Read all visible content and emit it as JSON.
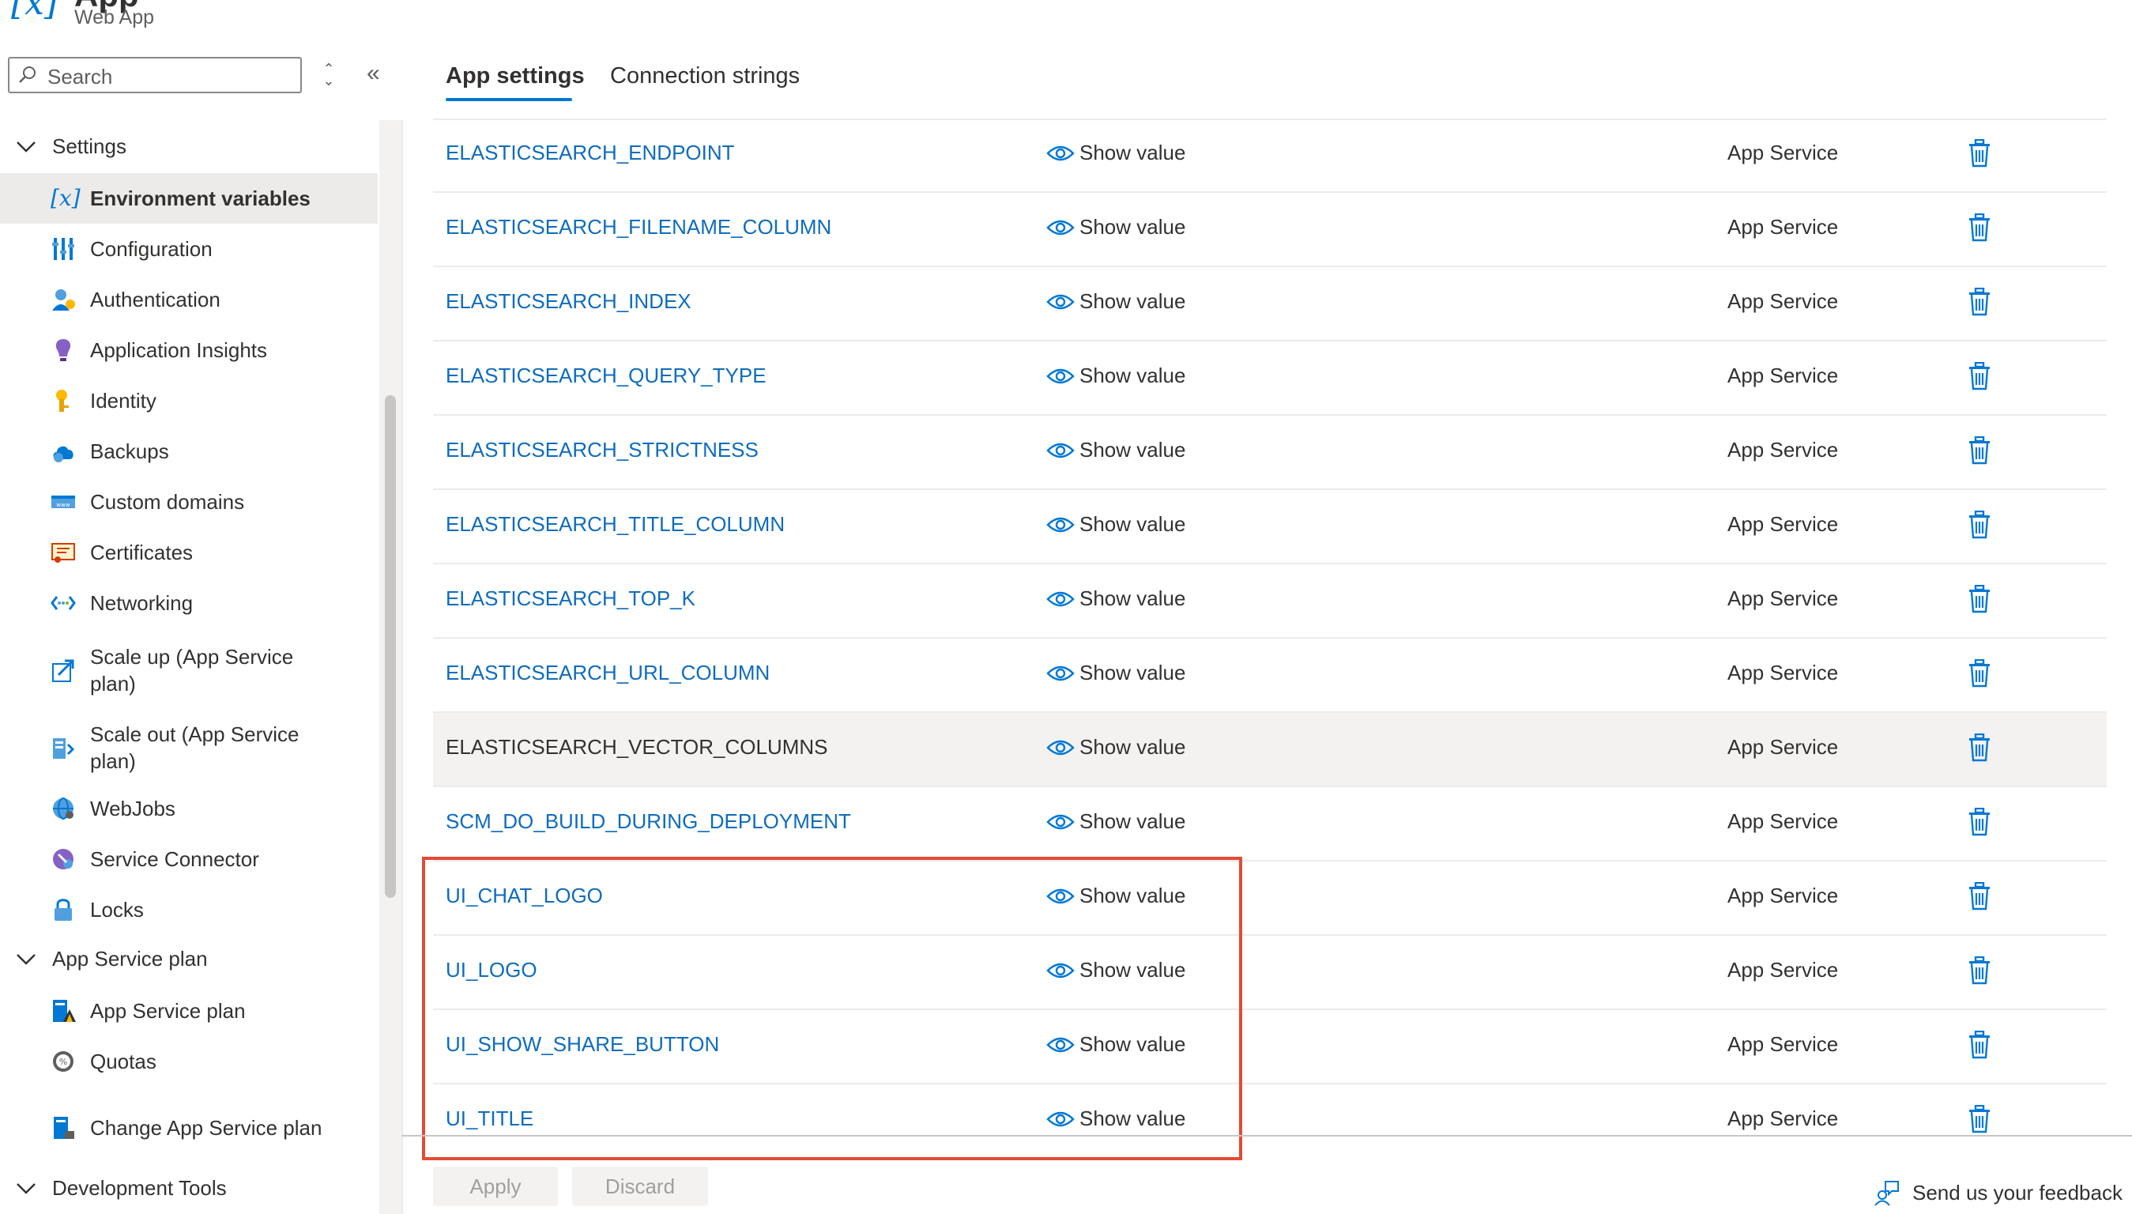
{
  "header": {
    "title": "[x]",
    "app_name": "App",
    "subtitle": "Web App"
  },
  "sidebar": {
    "search_placeholder": "Search",
    "groups": [
      {
        "label": "Settings"
      },
      {
        "label": "App Service plan"
      },
      {
        "label": "Development Tools"
      }
    ],
    "settings_items": [
      {
        "label": "Environment variables",
        "icon": "environment-variables-icon"
      },
      {
        "label": "Configuration",
        "icon": "configuration-icon"
      },
      {
        "label": "Authentication",
        "icon": "authentication-icon"
      },
      {
        "label": "Application Insights",
        "icon": "application-insights-icon"
      },
      {
        "label": "Identity",
        "icon": "identity-icon"
      },
      {
        "label": "Backups",
        "icon": "backups-icon"
      },
      {
        "label": "Custom domains",
        "icon": "custom-domains-icon"
      },
      {
        "label": "Certificates",
        "icon": "certificates-icon"
      },
      {
        "label": "Networking",
        "icon": "networking-icon"
      },
      {
        "label": "Scale up (App Service plan)",
        "icon": "scale-up-icon"
      },
      {
        "label": "Scale out (App Service plan)",
        "icon": "scale-out-icon"
      },
      {
        "label": "WebJobs",
        "icon": "webjobs-icon"
      },
      {
        "label": "Service Connector",
        "icon": "service-connector-icon"
      },
      {
        "label": "Locks",
        "icon": "locks-icon"
      }
    ],
    "plan_items": [
      {
        "label": "App Service plan",
        "icon": "app-service-plan-icon"
      },
      {
        "label": "Quotas",
        "icon": "quotas-icon"
      },
      {
        "label": "Change App Service plan",
        "icon": "change-plan-icon"
      }
    ]
  },
  "tabs": [
    {
      "label": "App settings"
    },
    {
      "label": "Connection strings"
    }
  ],
  "settings": [
    {
      "name": "ELASTICSEARCH_ENDPOINT",
      "action": "Show value",
      "source": "App Service"
    },
    {
      "name": "ELASTICSEARCH_FILENAME_COLUMN",
      "action": "Show value",
      "source": "App Service"
    },
    {
      "name": "ELASTICSEARCH_INDEX",
      "action": "Show value",
      "source": "App Service"
    },
    {
      "name": "ELASTICSEARCH_QUERY_TYPE",
      "action": "Show value",
      "source": "App Service"
    },
    {
      "name": "ELASTICSEARCH_STRICTNESS",
      "action": "Show value",
      "source": "App Service"
    },
    {
      "name": "ELASTICSEARCH_TITLE_COLUMN",
      "action": "Show value",
      "source": "App Service"
    },
    {
      "name": "ELASTICSEARCH_TOP_K",
      "action": "Show value",
      "source": "App Service"
    },
    {
      "name": "ELASTICSEARCH_URL_COLUMN",
      "action": "Show value",
      "source": "App Service"
    },
    {
      "name": "ELASTICSEARCH_VECTOR_COLUMNS",
      "action": "Show value",
      "source": "App Service"
    },
    {
      "name": "SCM_DO_BUILD_DURING_DEPLOYMENT",
      "action": "Show value",
      "source": "App Service"
    },
    {
      "name": "UI_CHAT_LOGO",
      "action": "Show value",
      "source": "App Service"
    },
    {
      "name": "UI_LOGO",
      "action": "Show value",
      "source": "App Service"
    },
    {
      "name": "UI_SHOW_SHARE_BUTTON",
      "action": "Show value",
      "source": "App Service"
    },
    {
      "name": "UI_TITLE",
      "action": "Show value",
      "source": "App Service"
    }
  ],
  "footer": {
    "apply_label": "Apply",
    "discard_label": "Discard",
    "feedback_label": "Send us your feedback"
  },
  "colors": {
    "accent": "#0078d4",
    "link": "#0f6cbd",
    "highlight": "#e34b34"
  }
}
